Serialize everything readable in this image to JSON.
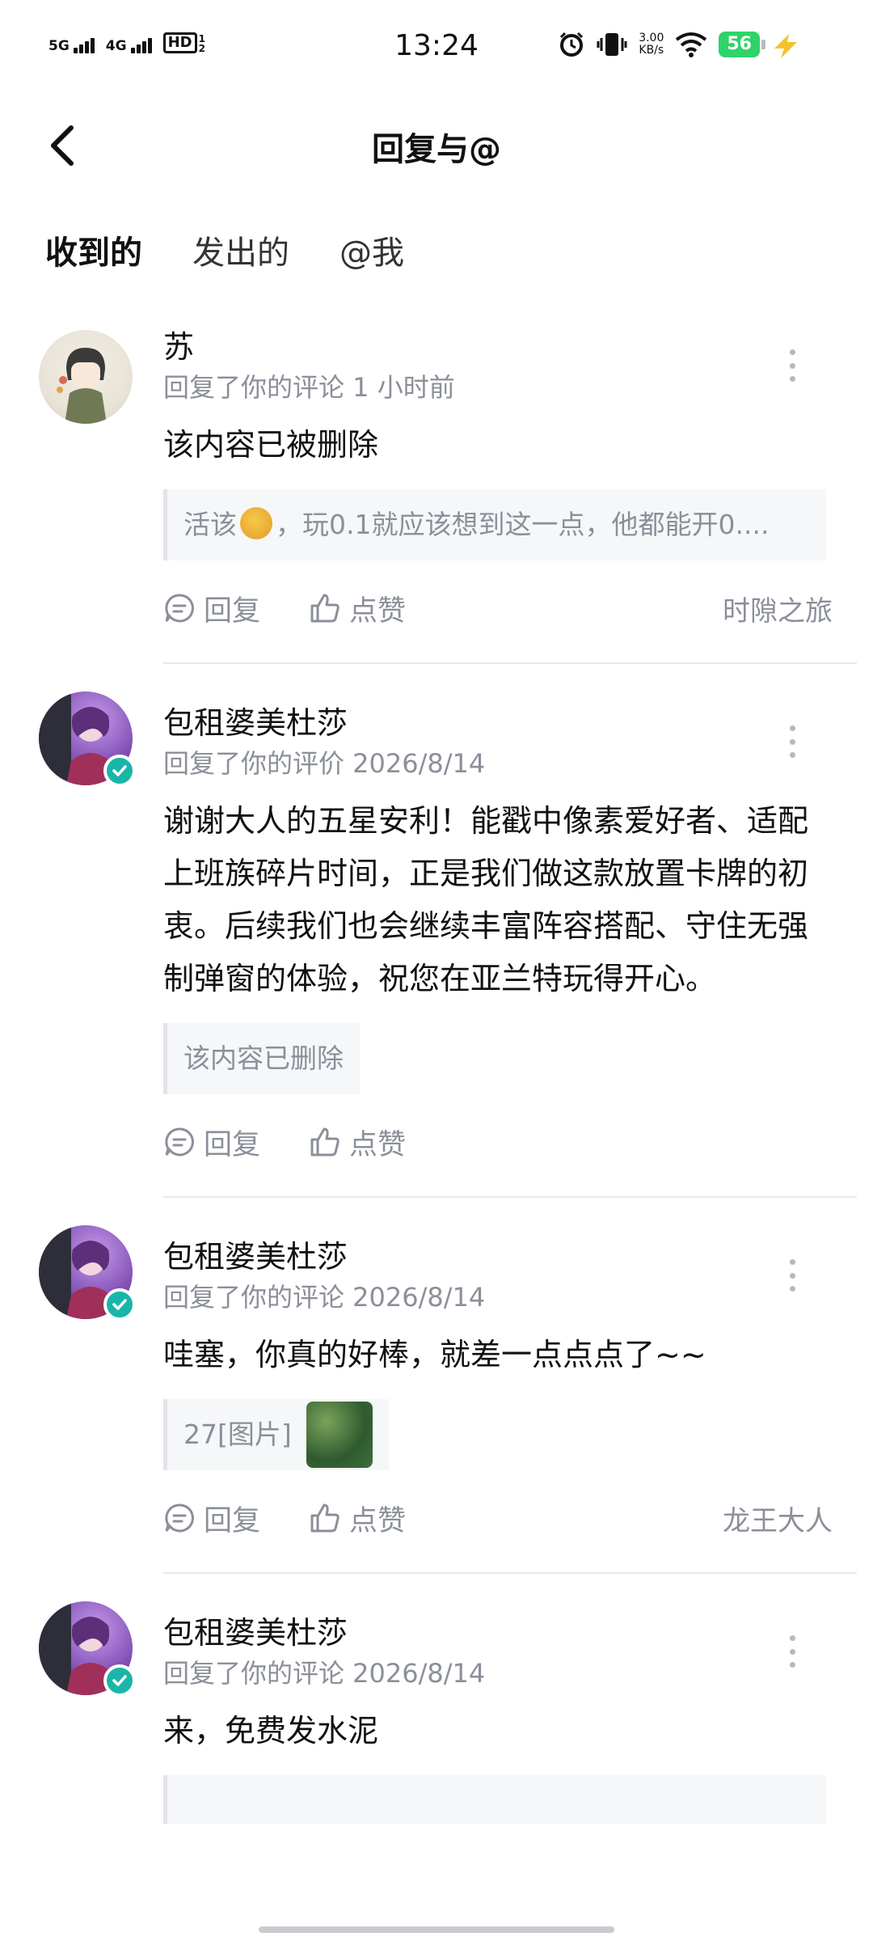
{
  "status_bar": {
    "time": "13:24",
    "sig1": "5G",
    "sig2": "4G",
    "hd": "HD",
    "hd_sub": "1 2",
    "net_speed_value": "3.00",
    "net_speed_unit": "KB/s",
    "battery": "56"
  },
  "header": {
    "title": "回复与@"
  },
  "tabs": [
    {
      "label": "收到的",
      "active": true
    },
    {
      "label": "发出的",
      "active": false
    },
    {
      "label": "@我",
      "active": false
    }
  ],
  "actions": {
    "reply": "回复",
    "like": "点赞"
  },
  "items": [
    {
      "name": "苏",
      "meta": "回复了你的评论 1 小时前",
      "content": "该内容已被删除",
      "quote_before": "活该",
      "quote_after": "，玩0.1就应该想到这一点，他都能开0....",
      "source": "时隙之旅"
    },
    {
      "name": "包租婆美杜莎",
      "meta": "回复了你的评价 2026/8/14",
      "content": "谢谢大人的五星安利！能戳中像素爱好者、适配上班族碎片时间，正是我们做这款放置卡牌的初衷。后续我们也会继续丰富阵容搭配、守住无强制弹窗的体验，祝您在亚兰特玩得开心。",
      "quote": "该内容已删除"
    },
    {
      "name": "包租婆美杜莎",
      "meta": "回复了你的评论 2026/8/14",
      "content": "哇塞，你真的好棒，就差一点点点了~~",
      "quote": "27[图片]",
      "source": "龙王大人"
    },
    {
      "name": "包租婆美杜莎",
      "meta": "回复了你的评论 2026/8/14",
      "content": "来，免费发水泥"
    }
  ],
  "colors": {
    "accent": "#22c4c2",
    "muted_text": "#8b8f99",
    "verified_badge": "#1ab5a9",
    "battery": "#2fd36a"
  }
}
